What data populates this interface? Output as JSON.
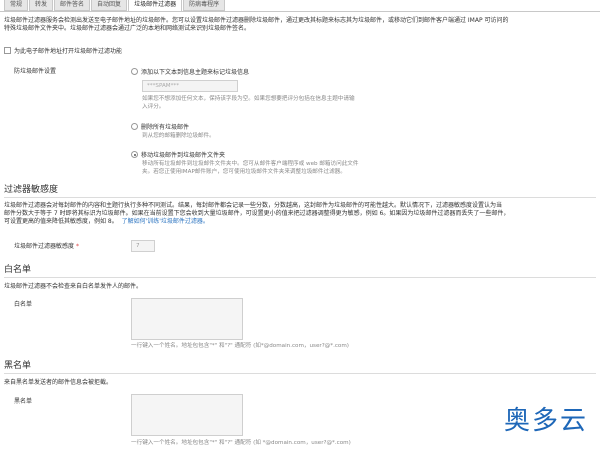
{
  "tabs": [
    {
      "label": "常规",
      "active": false
    },
    {
      "label": "转发",
      "active": false
    },
    {
      "label": "邮件答名",
      "active": false
    },
    {
      "label": "自动回复",
      "active": false
    },
    {
      "label": "垃圾邮件过滤器",
      "active": true
    },
    {
      "label": "防病毒程序",
      "active": false
    }
  ],
  "intro": [
    "垃圾邮件过滤器服务会检测出发送至电子邮件地址的垃圾邮件。您可以设置垃圾邮件过滤器删除垃圾邮件，通过更改其标题来标志其为垃圾邮件，或移动它们到邮件客户端通过 IMAP 可访问的",
    "特殊垃圾邮件文件夹中。垃圾邮件过滤器会通过广泛的本地和网络测试来识别垃圾邮件签名。"
  ],
  "enable_filter_label": "为此电子邮件地址打开垃圾邮件过滤功能",
  "spam_settings_label": "防垃圾邮件设置",
  "option1": {
    "label": "添加以下文本到信息主题来标记垃圾信息",
    "input_placeholder": "***SPAM***",
    "hint": [
      "如果您不想添加任何文本，保持该字段为空。如果您想要把评分包括在信息主题中请输",
      "入评分。"
    ]
  },
  "option2": {
    "label": "删除所有垃圾邮件",
    "hint": "到从您的邮箱删除垃圾邮件。"
  },
  "option3": {
    "label": "移动垃圾邮件到垃圾邮件文件夹",
    "hint": [
      "移动所有垃圾邮件到垃圾邮件文件夹中。您可从邮件客户端程序或 web 邮箱访问此文件",
      "夹。若您正使用IMAP邮件账户，您可使用垃圾邮件文件夹来调整垃圾邮件过滤器。"
    ]
  },
  "sensitivity": {
    "title": "过滤器敏感度",
    "desc": [
      "垃圾邮件过滤器会对每封邮件的内容和主题行执行多种不同测试。结果，每封邮件都会记录一些分数，分数越高，这封邮件为垃圾邮件的可能性越大。默认情况下，过滤器敏感度设置认为当",
      "邮件分数大于等于 7 时即将其标识为垃圾邮件。如果在当前设置下您会收到大量垃圾邮件，可设置更小的值来把过滤器调整得更为敏感，例如 6。如果因为垃圾邮件过滤器而丢失了一些邮件，",
      "可设置更高的值来降低其敏感度，例如 8。"
    ],
    "learn_link": "了解如何'训练'垃圾邮件过滤器。",
    "field_label": "垃圾邮件过滤器敏感度",
    "required_mark": "*",
    "value": "7"
  },
  "whitelist": {
    "title": "白名单",
    "desc": "垃圾邮件过滤器不会检查来自白名单发件人的邮件。",
    "field_label": "白名单",
    "hint": "一行键入一个姓名。地址包包含\"*\" 和\"?\" 通配符 (如*@domain.com，user?@*.com)"
  },
  "blacklist": {
    "title": "黑名单",
    "desc": "来自黑名单发送者的邮件信息会被拒截。",
    "field_label": "黑名单",
    "hint": "一行键入一个姓名。地址包包含\"*\" 和\"?\" 通配符 (如 *@domain.com，user?@*.com)"
  },
  "watermark": "奥多云"
}
